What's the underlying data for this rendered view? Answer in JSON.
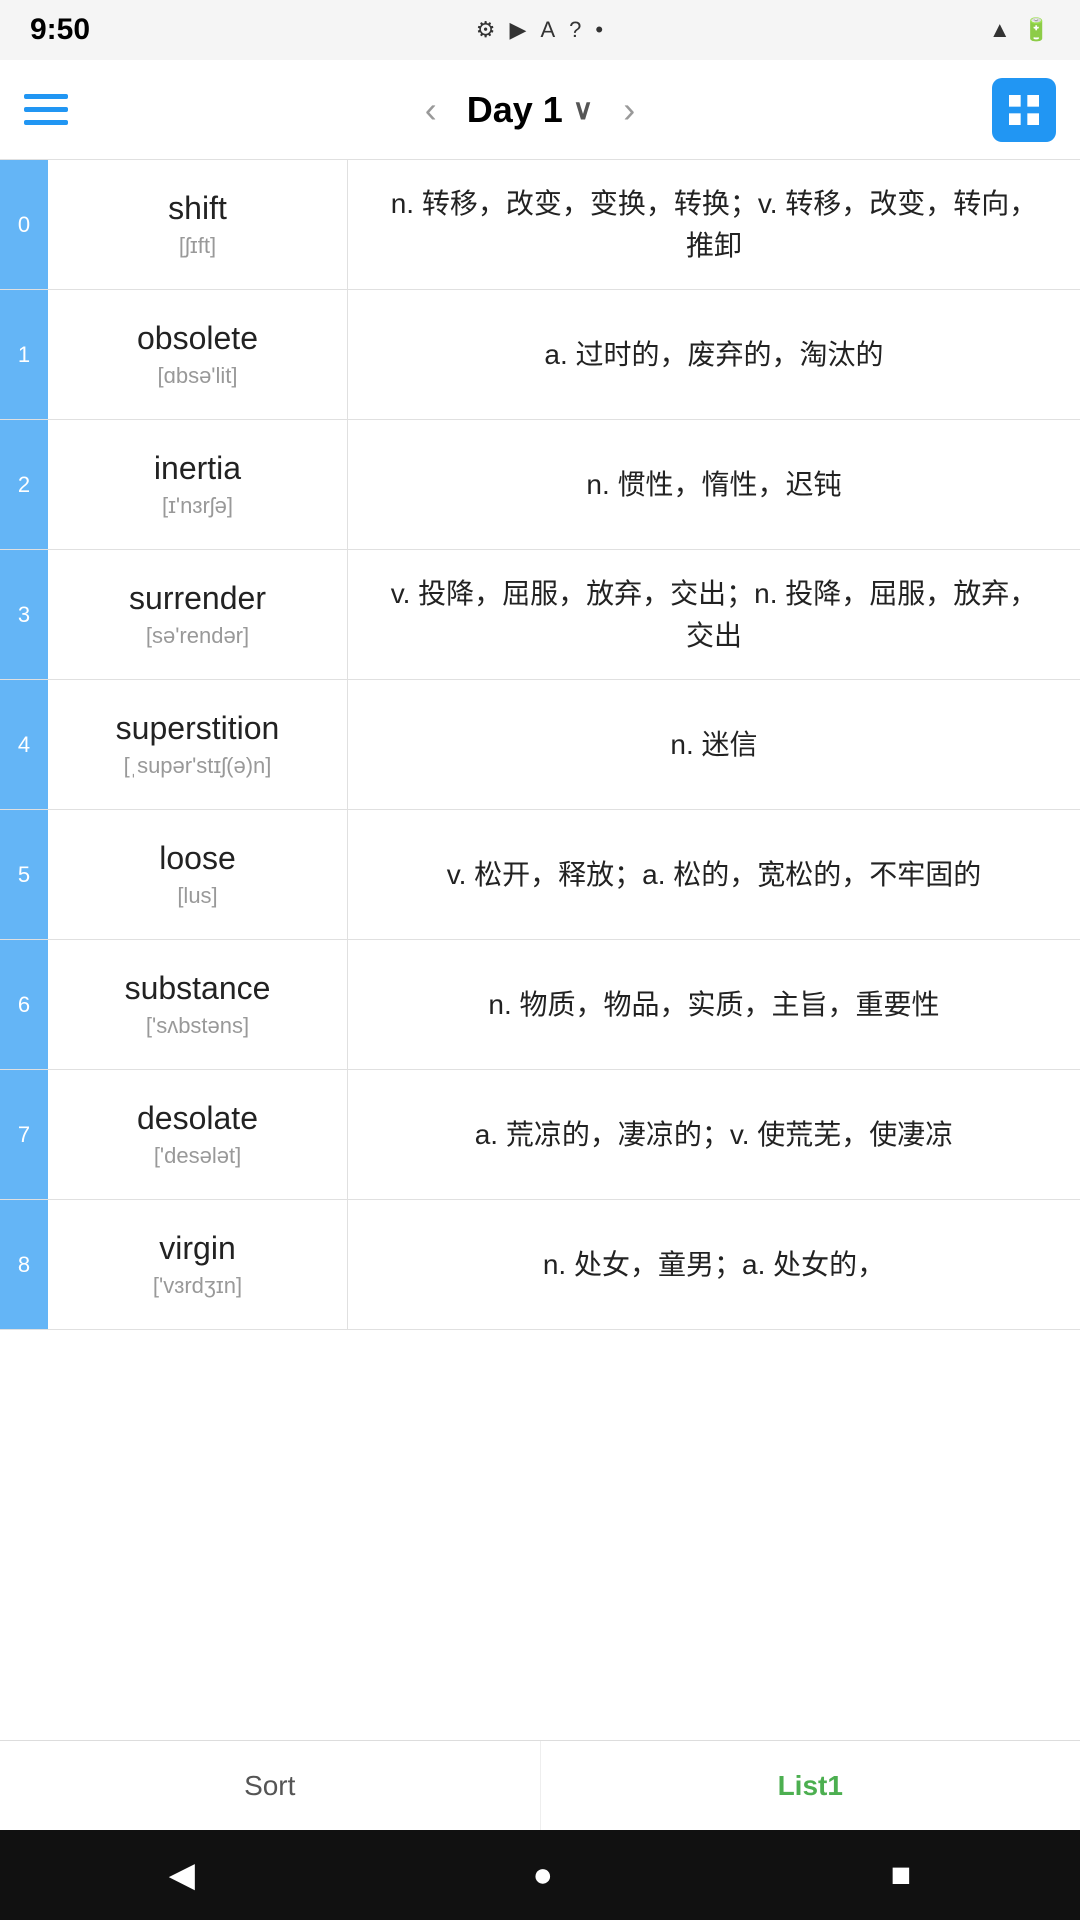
{
  "statusBar": {
    "time": "9:50",
    "icons": [
      "⚙",
      "▶",
      "A",
      "?",
      "•"
    ],
    "rightIcons": [
      "signal",
      "battery"
    ]
  },
  "toolbar": {
    "title": "Day 1",
    "prevLabel": "‹",
    "nextLabel": "›"
  },
  "words": [
    {
      "index": "0",
      "word": "shift",
      "phonetic": "[ʃɪft]",
      "definition": "n. 转移，改变，变换，转换；v. 转移，改变，转向，推卸"
    },
    {
      "index": "1",
      "word": "obsolete",
      "phonetic": "[ɑbsə'lit]",
      "definition": "a. 过时的，废弃的，淘汰的"
    },
    {
      "index": "2",
      "word": "inertia",
      "phonetic": "[ɪ'nɜrʃə]",
      "definition": "n. 惯性，惰性，迟钝"
    },
    {
      "index": "3",
      "word": "surrender",
      "phonetic": "[sə'rendər]",
      "definition": "v. 投降，屈服，放弃，交出；n. 投降，屈服，放弃，交出"
    },
    {
      "index": "4",
      "word": "superstition",
      "phonetic": "[ˌsupər'stɪʃ(ə)n]",
      "definition": "n. 迷信"
    },
    {
      "index": "5",
      "word": "loose",
      "phonetic": "[lus]",
      "definition": "v. 松开，释放；a. 松的，宽松的，不牢固的"
    },
    {
      "index": "6",
      "word": "substance",
      "phonetic": "['sʌbstəns]",
      "definition": "n. 物质，物品，实质，主旨，重要性"
    },
    {
      "index": "7",
      "word": "desolate",
      "phonetic": "['desələt]",
      "definition": "a. 荒凉的，凄凉的；v. 使荒芜，使凄凉"
    },
    {
      "index": "8",
      "word": "virgin",
      "phonetic": "['vɜrdʒɪn]",
      "definition": "n. 处女，童男；a. 处女的，"
    }
  ],
  "bottomTabs": [
    {
      "label": "Sort",
      "active": false
    },
    {
      "label": "List1",
      "active": true
    }
  ],
  "androidNav": {
    "backIcon": "◀",
    "homeIcon": "●",
    "recentIcon": "■"
  }
}
